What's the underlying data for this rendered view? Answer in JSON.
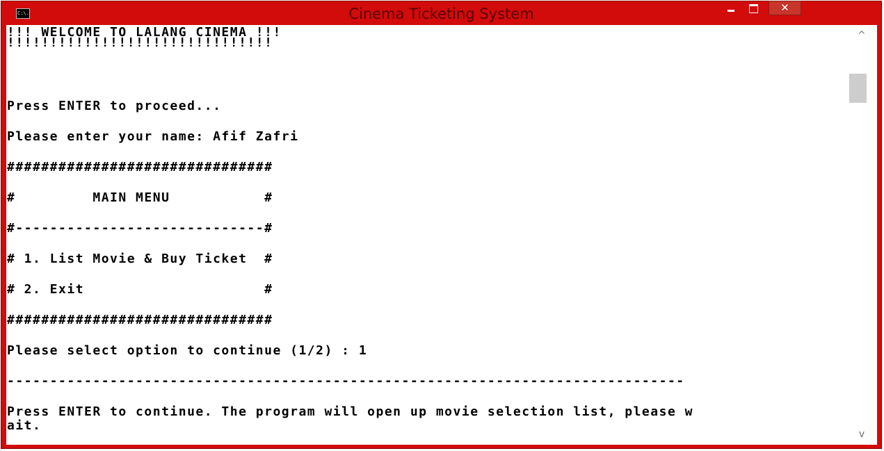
{
  "window": {
    "title": "Cinema Ticketing System",
    "icon": "cmd-icon",
    "icon_text": "C:\\.",
    "close_label": "✕",
    "accent_color": "#d20b0b"
  },
  "console": {
    "lines": [
      "!!! WELCOME TO LALANG CINEMA !!!",
      "!!!!!!!!!!!!!!!!!!!!!!!!!!!!!!!",
      "Press ENTER to proceed...",
      "Please enter your name: Afif Zafri",
      "###############################",
      "#         MAIN MENU           #",
      "#-----------------------------#",
      "# 1. List Movie & Buy Ticket  #",
      "# 2. Exit                     #",
      "###############################",
      "Please select option to continue (1/2) : 1",
      "-------------------------------------------------------------------------------",
      "Press ENTER to continue. The program will open up movie selection list, please w",
      "ait."
    ]
  },
  "scrollbar": {
    "up_arrow": "^",
    "down_arrow": "v"
  }
}
